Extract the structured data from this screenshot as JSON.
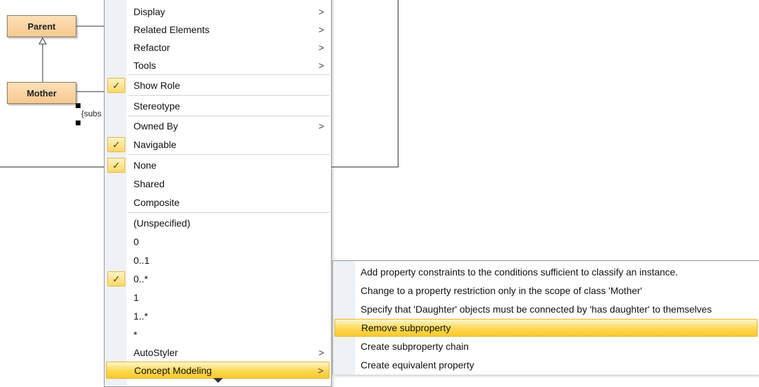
{
  "diagram": {
    "classes": [
      {
        "name": "Parent"
      },
      {
        "name": "Mother"
      }
    ],
    "constraint_text": "{subs"
  },
  "context_menu": {
    "items": [
      {
        "label": "Display",
        "submenu": true,
        "checked": false
      },
      {
        "label": "Related Elements",
        "submenu": true,
        "checked": false
      },
      {
        "label": "Refactor",
        "submenu": true,
        "checked": false
      },
      {
        "label": "Tools",
        "submenu": true,
        "checked": false
      },
      {
        "label": "Show Role",
        "submenu": false,
        "checked": true
      },
      {
        "label": "Stereotype",
        "submenu": false,
        "checked": false
      },
      {
        "label": "Owned By",
        "submenu": true,
        "checked": false
      },
      {
        "label": "Navigable",
        "submenu": false,
        "checked": true
      },
      {
        "label": "None",
        "submenu": false,
        "checked": true
      },
      {
        "label": "Shared",
        "submenu": false,
        "checked": false
      },
      {
        "label": "Composite",
        "submenu": false,
        "checked": false
      },
      {
        "label": "(Unspecified)",
        "submenu": false,
        "checked": false
      },
      {
        "label": "0",
        "submenu": false,
        "checked": false
      },
      {
        "label": "0..1",
        "submenu": false,
        "checked": false
      },
      {
        "label": "0..*",
        "submenu": false,
        "checked": true
      },
      {
        "label": "1",
        "submenu": false,
        "checked": false
      },
      {
        "label": "1..*",
        "submenu": false,
        "checked": false
      },
      {
        "label": "*",
        "submenu": false,
        "checked": false
      },
      {
        "label": "AutoStyler",
        "submenu": true,
        "checked": false
      },
      {
        "label": "Concept Modeling",
        "submenu": true,
        "checked": false,
        "highlighted": true
      }
    ],
    "arrow_glyph": ">",
    "check_glyph": "✓"
  },
  "submenu": {
    "items": [
      {
        "label": "Add property constraints to the conditions sufficient to classify an instance."
      },
      {
        "label": "Change to a property restriction only in the scope of class 'Mother'"
      },
      {
        "label": "Specify that 'Daughter' objects must be connected by 'has daughter' to themselves"
      },
      {
        "label": "Remove subproperty",
        "highlighted": true
      },
      {
        "label": "Create subproperty chain"
      },
      {
        "label": "Create equivalent property"
      }
    ]
  },
  "colors": {
    "highlight": "#fcd84f",
    "class_fill": "#f6c98f",
    "gutter": "#eef1f5"
  }
}
